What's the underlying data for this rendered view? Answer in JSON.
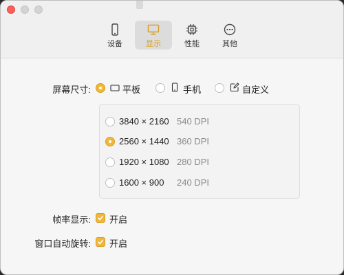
{
  "window": {
    "controls": [
      "close",
      "minimize",
      "maximize"
    ]
  },
  "tabs": [
    {
      "label": "设备",
      "icon": "phone-icon",
      "active": false
    },
    {
      "label": "显示",
      "icon": "monitor-icon",
      "active": true
    },
    {
      "label": "性能",
      "icon": "cpu-icon",
      "active": false
    },
    {
      "label": "其他",
      "icon": "more-icon",
      "active": false
    }
  ],
  "screen_size": {
    "label": "屏幕尺寸:",
    "options": [
      {
        "label": "平板",
        "icon": "tablet-icon",
        "selected": true
      },
      {
        "label": "手机",
        "icon": "phone-icon",
        "selected": false
      },
      {
        "label": "自定义",
        "icon": "edit-icon",
        "selected": false
      }
    ]
  },
  "resolutions": [
    {
      "resolution": "3840 × 2160",
      "dpi": "540 DPI",
      "selected": false
    },
    {
      "resolution": "2560 × 1440",
      "dpi": "360 DPI",
      "selected": true
    },
    {
      "resolution": "1920 × 1080",
      "dpi": "280 DPI",
      "selected": false
    },
    {
      "resolution": "1600 × 900",
      "dpi": "240 DPI",
      "selected": false
    }
  ],
  "frame_rate": {
    "label": "帧率显示:",
    "checkbox_label": "开启",
    "checked": true
  },
  "auto_rotate": {
    "label": "窗口自动旋转:",
    "checkbox_label": "开启",
    "checked": true
  },
  "colors": {
    "accent": "#f0b73a",
    "active_tab_text": "#d9a020"
  }
}
